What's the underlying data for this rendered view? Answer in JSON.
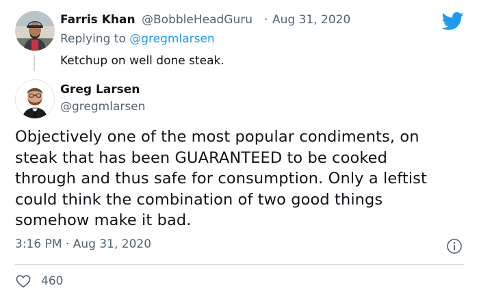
{
  "reply_tweet": {
    "display_name": "Farris Khan",
    "handle": "@BobbleHeadGuru",
    "separator": "·",
    "date": "Aug 31, 2020",
    "replying_prefix": "Replying to",
    "replying_to": "@gregmlarsen",
    "text": "Ketchup on well done steak."
  },
  "main_tweet": {
    "display_name": "Greg Larsen",
    "handle": "@gregmlarsen",
    "text_lines": [
      "Objectively one of the most popular condiments, on",
      "steak that has been GUARANTEED to be cooked",
      "through and thus safe for consumption. Only a leftist",
      "could think the combination of two good things",
      "somehow make it bad."
    ],
    "time": "3:16 PM",
    "separator": "·",
    "date": "Aug 31, 2020",
    "like_count": "460"
  },
  "icons": {
    "brand": "twitter-bird-icon",
    "info": "info-icon",
    "like": "heart-icon"
  },
  "colors": {
    "brand_blue": "#1d9bf0",
    "text_primary": "#0f1419",
    "text_secondary": "#536471",
    "divider": "#cfd9de"
  }
}
